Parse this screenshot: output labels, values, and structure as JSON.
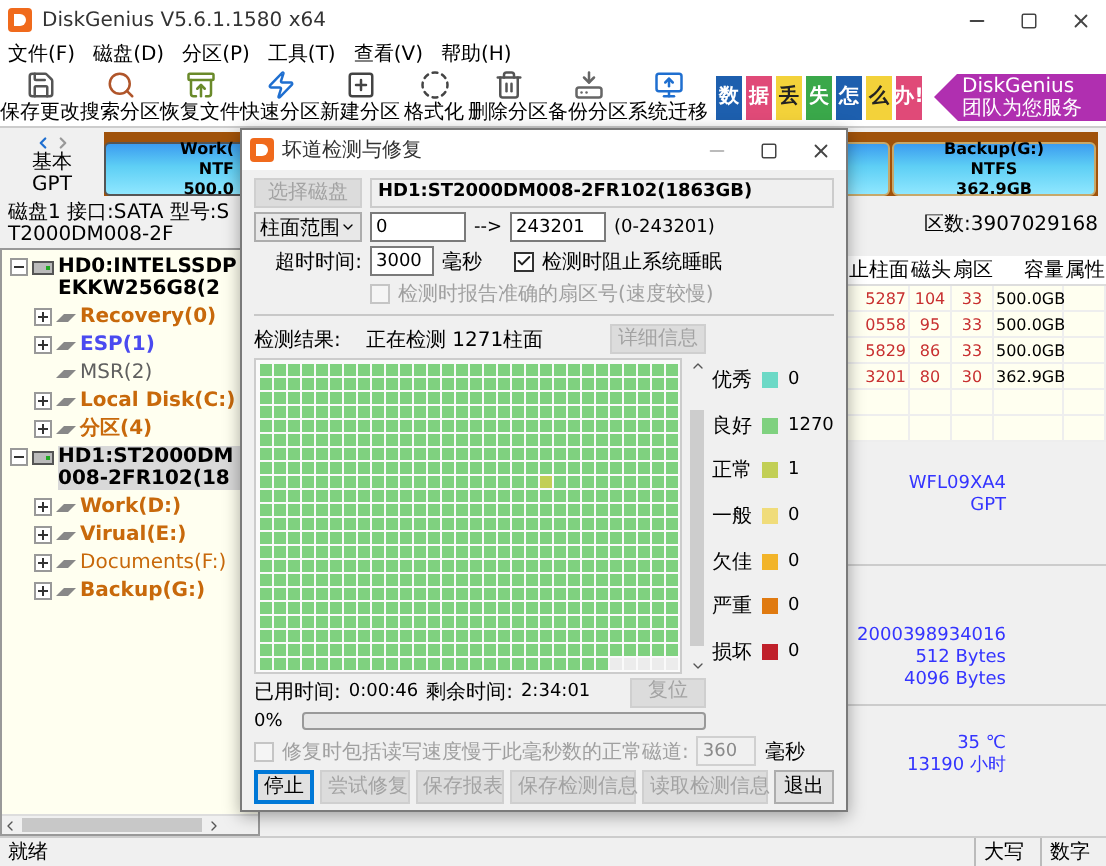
{
  "window": {
    "title": "DiskGenius V5.6.1.1580 x64"
  },
  "menu": [
    "文件(F)",
    "磁盘(D)",
    "分区(P)",
    "工具(T)",
    "查看(V)",
    "帮助(H)"
  ],
  "toolbar": [
    "保存更改",
    "搜索分区",
    "恢复文件",
    "快速分区",
    "新建分区",
    "格式化",
    "删除分区",
    "备份分区",
    "系统迁移"
  ],
  "banner": {
    "tiles": [
      {
        "text": "数",
        "color": "#1d5fae"
      },
      {
        "text": "据",
        "color": "#e04a78"
      },
      {
        "text": "丢",
        "color": "#f3d23a"
      },
      {
        "text": "失",
        "color": "#3aa84a"
      },
      {
        "text": "怎",
        "color": "#1d5fae"
      },
      {
        "text": "么",
        "color": "#f3d23a"
      },
      {
        "text": "办!",
        "color": "#e04a78"
      }
    ],
    "slogan": "DiskGenius 团队为您服务"
  },
  "disk_map": {
    "type": "基本",
    "style": "GPT",
    "partitions": [
      {
        "name": "Work(",
        "fs": "NTF",
        "size": "500.0",
        "selected": true
      },
      {
        "name": "Backup(G:)",
        "fs": "NTFS",
        "size": "362.9GB",
        "selected": false
      }
    ]
  },
  "disk_info": {
    "left": "磁盘1 接口:SATA 型号:ST2000DM008-2F",
    "right": "区数:3907029168"
  },
  "tree": [
    {
      "label": "HD0:INTELSSDPEKKW256G8(2",
      "selected": false,
      "expanded": true,
      "children": [
        {
          "label": "Recovery(0)",
          "color": "#c8690b",
          "expander": true
        },
        {
          "label": "ESP(1)",
          "color": "#4a4af0",
          "expander": true
        },
        {
          "label": "MSR(2)",
          "color": "#606060",
          "expander": false
        },
        {
          "label": "Local Disk(C:)",
          "color": "#c8690b",
          "expander": true
        },
        {
          "label": "分区(4)",
          "color": "#c8690b",
          "expander": true
        }
      ]
    },
    {
      "label": "HD1:ST2000DM008-2FR102(18",
      "selected": true,
      "expanded": true,
      "children": [
        {
          "label": "Work(D:)",
          "color": "#c8690b",
          "expander": true
        },
        {
          "label": "Virual(E:)",
          "color": "#c8690b",
          "expander": true
        },
        {
          "label": "Documents(F:)",
          "color": "#c8690b",
          "expander": true
        },
        {
          "label": "Backup(G:)",
          "color": "#c8690b",
          "expander": true
        }
      ]
    }
  ],
  "table": {
    "columns": [
      "止柱面",
      "磁头",
      "扇区",
      "容量",
      "属性"
    ],
    "rows": [
      [
        "5287",
        "104",
        "33",
        "500.0GB"
      ],
      [
        "0558",
        "95",
        "33",
        "500.0GB"
      ],
      [
        "5829",
        "86",
        "33",
        "500.0GB"
      ],
      [
        "3201",
        "80",
        "30",
        "362.9GB"
      ]
    ]
  },
  "details": [
    [
      "WFL09XA4",
      "GPT"
    ],
    [
      "2000398934016",
      "512 Bytes",
      "4096 Bytes"
    ],
    [
      "35 ℃",
      "13190 小时"
    ]
  ],
  "status_bar": {
    "text": "就绪",
    "indicators": [
      "大写",
      "数字"
    ]
  },
  "dialog": {
    "title": "坏道检测与修复",
    "select_disk": {
      "label": "选择磁盘",
      "disabled": true
    },
    "disk_name": "HD1:ST2000DM008-2FR102(1863GB)",
    "range": {
      "mode": "柱面范围",
      "from": "0",
      "arrow": "-->",
      "to": "243201",
      "limits": "(0-243201)"
    },
    "timeout": {
      "label": "超时时间:",
      "value": "3000",
      "unit": "毫秒"
    },
    "options": [
      {
        "label": "检测时阻止系统睡眠",
        "checked": true,
        "disabled": false
      },
      {
        "label": "检测时报告准确的扇区号(速度较慢)",
        "checked": false,
        "disabled": true
      }
    ],
    "result": {
      "label": "检测结果:",
      "status": "正在检测 1271柱面",
      "details_button": {
        "label": "详细信息",
        "disabled": true
      }
    },
    "legend": [
      {
        "label": "优秀",
        "count": "0",
        "color": "#6cd9c6"
      },
      {
        "label": "良好",
        "count": "1270",
        "color": "#7fd17f"
      },
      {
        "label": "正常",
        "count": "1",
        "color": "#c2cf55"
      },
      {
        "label": "一般",
        "count": "0",
        "color": "#f0dc7a"
      },
      {
        "label": "欠佳",
        "count": "0",
        "color": "#f2b429"
      },
      {
        "label": "严重",
        "count": "0",
        "color": "#e07a10"
      },
      {
        "label": "损坏",
        "count": "0",
        "color": "#c0202a"
      }
    ],
    "elapsed": {
      "label": "已用时间:",
      "value": "0:00:46"
    },
    "remaining": {
      "label": "剩余时间:",
      "value": "2:34:01"
    },
    "reset_button": {
      "label": "复位",
      "disabled": true
    },
    "progress": {
      "text": "0%",
      "level": 0
    },
    "repair_option": {
      "label": "修复时包括读写速度慢于此毫秒数的正常磁道:",
      "checked": false,
      "disabled": true,
      "value": "360",
      "unit": "毫秒"
    },
    "buttons": [
      {
        "label": "停止",
        "disabled": false,
        "default": true
      },
      {
        "label": "尝试修复",
        "disabled": true,
        "default": false
      },
      {
        "label": "保存报表",
        "disabled": true,
        "default": false
      },
      {
        "label": "保存检测信息",
        "disabled": true,
        "default": false
      },
      {
        "label": "读取检测信息",
        "disabled": true,
        "default": false
      },
      {
        "label": "退出",
        "disabled": false,
        "default": false
      }
    ]
  }
}
